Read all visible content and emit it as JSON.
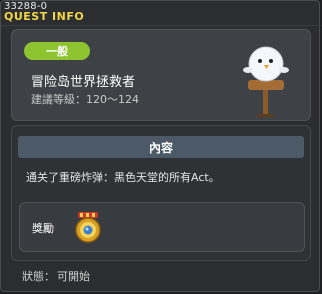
{
  "window": {
    "quest_id": "33288-0",
    "title": "QUEST INFO"
  },
  "quest": {
    "category": "一般",
    "name": "冒险岛世界拯救者",
    "level_requirement": "建議等級：120～124"
  },
  "content": {
    "header": "內容",
    "description": "通关了重磅炸弹：黑色天堂的所有Act。"
  },
  "reward": {
    "label": "獎勵",
    "item_icon": "medal-icon"
  },
  "status": {
    "label": "狀態：",
    "value": "可開始"
  },
  "colors": {
    "title_yellow": "#f2d645",
    "badge_green": "#8fc431",
    "section_header": "#4b5a66"
  }
}
